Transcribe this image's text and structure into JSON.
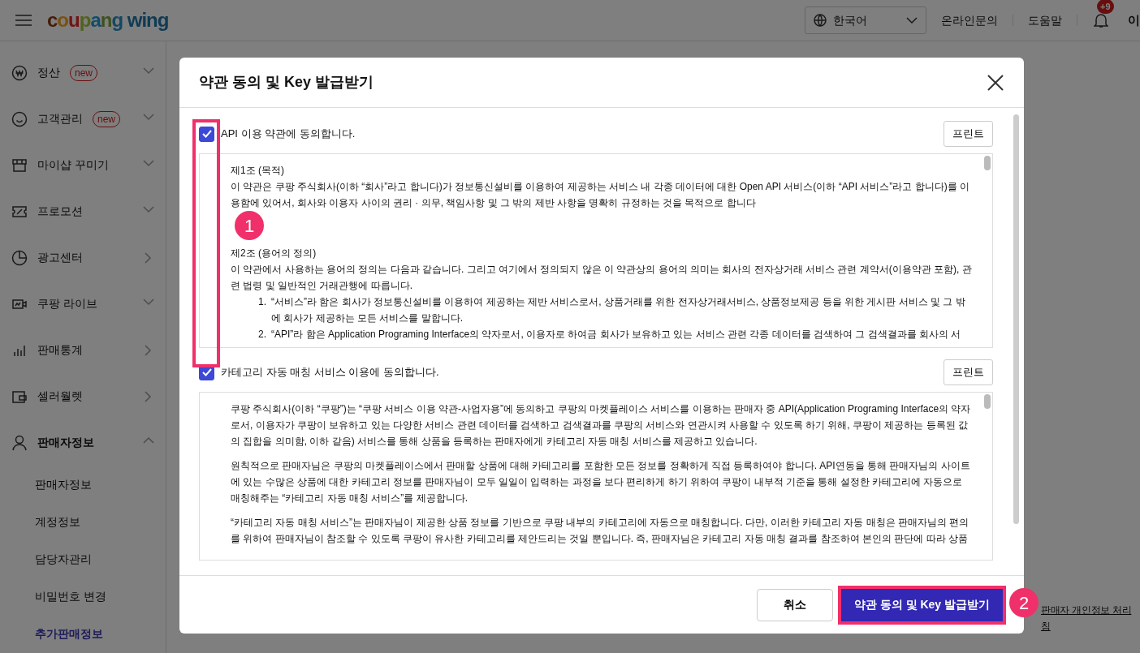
{
  "header": {
    "logo": "coupang wing",
    "language": "한국어",
    "links": [
      "온라인문의",
      "도움말"
    ],
    "notification_count": "+9",
    "user": "이"
  },
  "sidebar": {
    "items": [
      {
        "label": "정산",
        "badge": "new",
        "kind": "menu",
        "expanded": false
      },
      {
        "label": "고객관리",
        "badge": "new",
        "kind": "menu",
        "expanded": false
      },
      {
        "label": "마이샵 꾸미기",
        "kind": "menu",
        "expanded": false
      },
      {
        "label": "프로모션",
        "kind": "menu",
        "expanded": false
      },
      {
        "label": "광고센터",
        "kind": "link"
      },
      {
        "label": "쿠팡 라이브",
        "kind": "menu",
        "expanded": false
      },
      {
        "label": "판매통계",
        "kind": "link"
      },
      {
        "label": "셀러월렛",
        "kind": "link"
      },
      {
        "label": "판매자정보",
        "kind": "menu",
        "expanded": true,
        "children": [
          {
            "label": "판매자정보",
            "selected": false
          },
          {
            "label": "계정정보",
            "selected": false
          },
          {
            "label": "담당자관리",
            "selected": false
          },
          {
            "label": "비밀번호 변경",
            "selected": false
          },
          {
            "label": "추가판매정보",
            "selected": true
          }
        ]
      }
    ]
  },
  "background_link": [
    "판매자 개인정보 처리",
    "침"
  ],
  "modal": {
    "title": "약관 동의 및 Key 발급받기",
    "sections": [
      {
        "label": "API 이용 약관에 동의합니다.",
        "checked": true,
        "print": "프린트",
        "blocks": [
          {
            "kind": "heading",
            "text": "제1조 (목적)"
          },
          {
            "kind": "para",
            "text": "이 약관은 쿠팡 주식회사(이하 “회사”라고 합니다)가 정보통신설비를 이용하여 제공하는 서비스 내 각종 데이터에 대한 Open API 서비스(이하 “API 서비스”라고 합니다)를 이용함에 있어서, 회사와 이용자 사이의 권리 · 의무, 책임사항 및 그 밖의 제반 사항을 명확히 규정하는 것을 목적으로 합니다"
          },
          {
            "kind": "heading",
            "text": "제2조 (용어의 정의)"
          },
          {
            "kind": "para",
            "text": "이 약관에서 사용하는 용어의 정의는 다음과 같습니다. 그리고 여기에서 정의되지 않은 이 약관상의 용어의 의미는 회사의 전자상거래 서비스 관련 계약서(이용약관 포함), 관련 법령 및 일반적인 거래관행에 따릅니다."
          },
          {
            "kind": "item",
            "number": "1.",
            "text": "“서비스”라 함은 회사가 정보통신설비를 이용하여 제공하는 제반 서비스로서, 상품거래를 위한 전자상거래서비스, 상품정보제공 등을 위한 게시판 서비스 및 그 밖에 회사가 제공하는 모든 서비스를 말합니다."
          },
          {
            "kind": "item",
            "number": "2.",
            "text": "“API”라 함은 Application Programing Interface의 약자로서, 이용자로 하여금 회사가 보유하고 있는 서비스 관련 각종 데이터를 검색하여 그 검색결과를 회사의 서"
          }
        ]
      },
      {
        "label": "카테고리 자동 매칭 서비스 이용에 동의합니다.",
        "checked": true,
        "print": "프린트",
        "blocks": [
          {
            "kind": "para",
            "text": "쿠팡 주식회사(이하 “쿠팡”)는 “쿠팡 서비스 이용 약관-사업자용”에 동의하고 쿠팡의 마켓플레이스 서비스를 이용하는 판매자 중 API(Application Programing Interface의 약자로서, 이용자가 쿠팡이 보유하고 있는 다양한 서비스 관련 데이터를 검색하고 검색결과를 쿠팡의 서비스와 연관시켜 사용할 수 있도록 하기 위해, 쿠팡이 제공하는 등록된 값의 집합을 의미함, 이하 같음) 서비스를 통해 상품을 등록하는 판매자에게 카테고리 자동 매칭 서비스를 제공하고 있습니다."
          },
          {
            "kind": "para",
            "text": "원칙적으로 판매자님은 쿠팡의 마켓플레이스에서 판매할 상품에 대해 카테고리를 포함한 모든 정보를 정확하게 직접 등록하여야 합니다. API연동을 통해 판매자님의 사이트에 있는 수많은 상품에 대한 카테고리 정보를 판매자님이 모두 일일이 입력하는 과정을 보다 편리하게 하기 위하여 쿠팡이 내부적 기준을 통해 설정한 카테고리에 자동으로 매칭해주는 “카테고리 자동 매칭 서비스”를 제공합니다."
          },
          {
            "kind": "para",
            "text": "“카테고리 자동 매칭 서비스”는 판매자님이 제공한 상품 정보를 기반으로 쿠팡 내부의 카테고리에 자동으로 매칭합니다. 다만, 이러한 카테고리 자동 매칭은 판매자님의 편의를 위하여 판매자님이 참조할 수 있도록 쿠팡이 유사한 카테고리를 제안드리는 것일 뿐입니다. 즉, 판매자님은 카테고리 자동 매칭 결과를 참조하여 본인의 판단에 따라 상품"
          }
        ]
      }
    ],
    "cancel": "취소",
    "confirm": "약관 동의 및 Key 발급받기"
  },
  "annotations": [
    "1",
    "2"
  ]
}
